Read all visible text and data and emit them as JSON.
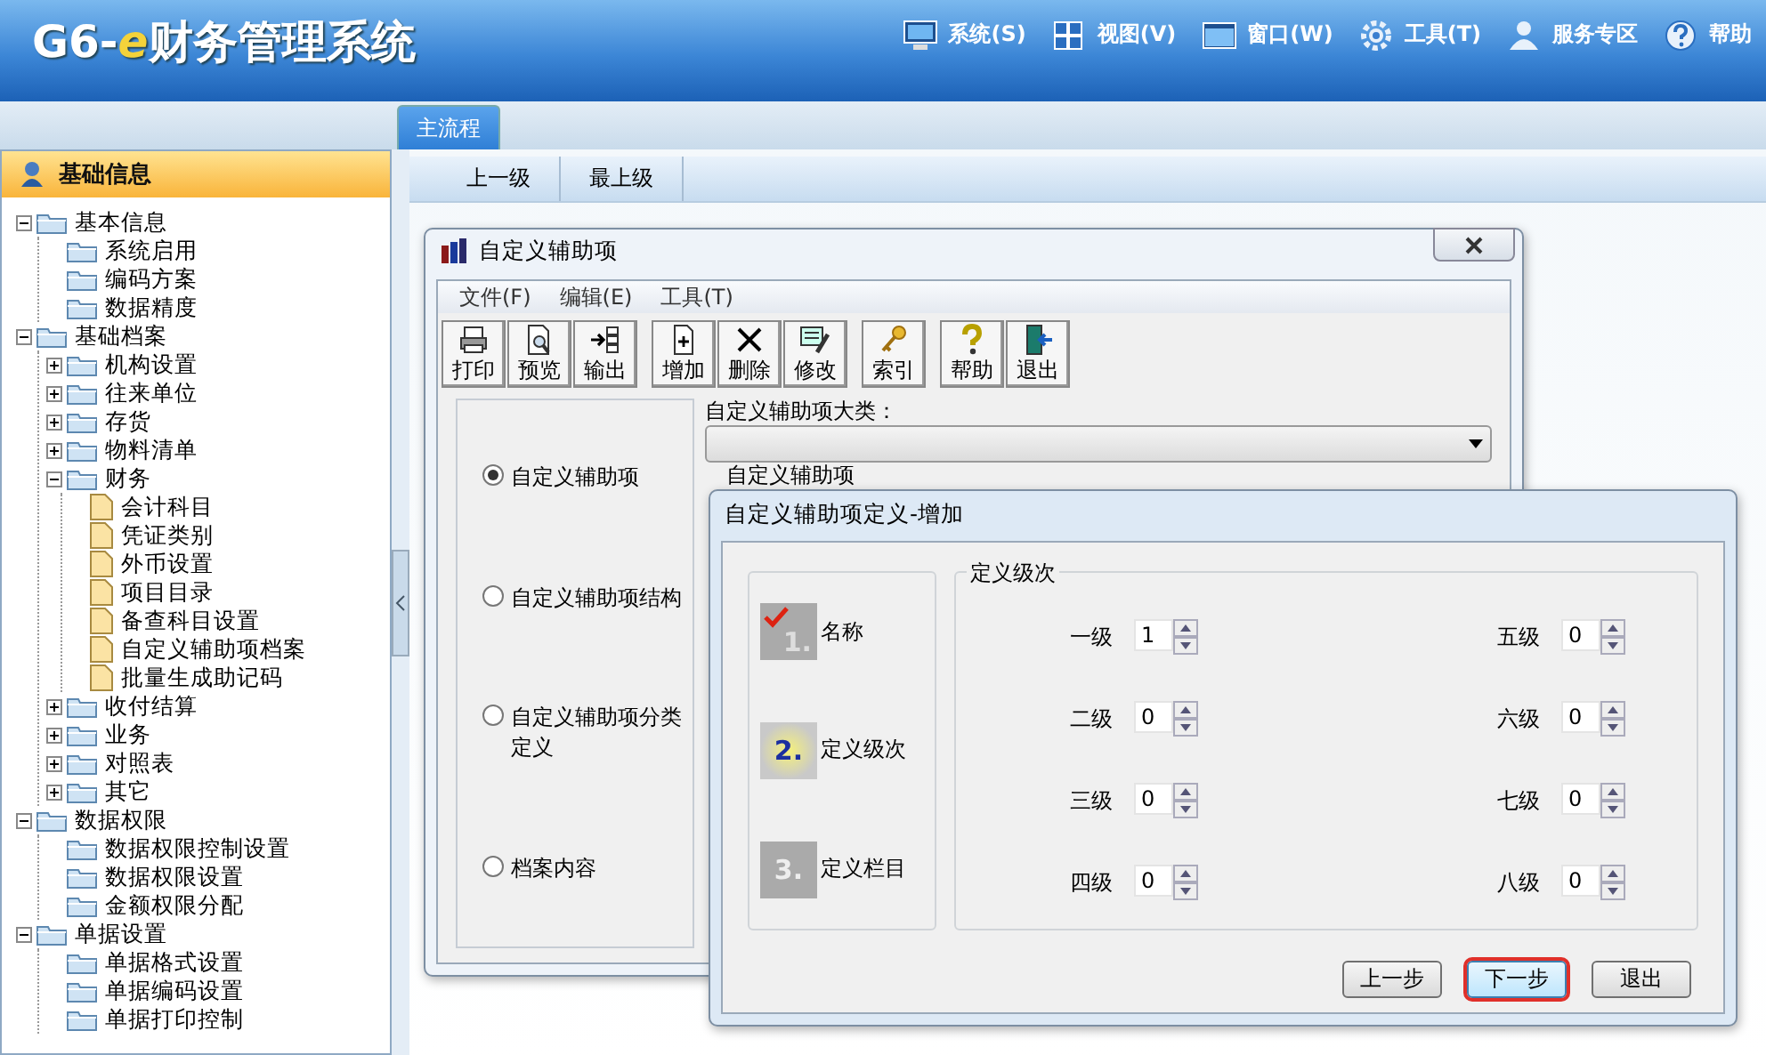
{
  "header": {
    "logo": {
      "prefix": "G6-",
      "accent": "e",
      "name": "财务管理系统"
    },
    "menu": [
      {
        "label": "系统(S)",
        "kind": "monitor"
      },
      {
        "label": "视图(V)",
        "kind": "grid"
      },
      {
        "label": "窗口(W)",
        "kind": "window"
      },
      {
        "label": "工具(T)",
        "kind": "gear"
      },
      {
        "label": "服务专区",
        "kind": "user"
      },
      {
        "label": "帮助",
        "kind": "help"
      }
    ]
  },
  "tabs": [
    {
      "label": "主流程",
      "selected": true
    }
  ],
  "sidebar": {
    "title": "基础信息",
    "tree": [
      {
        "label": "基本信息",
        "kind": "folder",
        "expanded": true,
        "children": [
          {
            "label": "系统启用",
            "kind": "folder"
          },
          {
            "label": "编码方案",
            "kind": "folder"
          },
          {
            "label": "数据精度",
            "kind": "folder"
          }
        ]
      },
      {
        "label": "基础档案",
        "kind": "folder",
        "expanded": true,
        "children": [
          {
            "label": "机构设置",
            "kind": "folder",
            "expanded": false
          },
          {
            "label": "往来单位",
            "kind": "folder",
            "expanded": false
          },
          {
            "label": "存货",
            "kind": "folder",
            "expanded": false
          },
          {
            "label": "物料清单",
            "kind": "folder",
            "expanded": false
          },
          {
            "label": "财务",
            "kind": "folder",
            "expanded": true,
            "children": [
              {
                "label": "会计科目",
                "kind": "document"
              },
              {
                "label": "凭证类别",
                "kind": "document"
              },
              {
                "label": "外币设置",
                "kind": "document"
              },
              {
                "label": "项目目录",
                "kind": "document"
              },
              {
                "label": "备查科目设置",
                "kind": "document"
              },
              {
                "label": "自定义辅助项档案",
                "kind": "document"
              },
              {
                "label": "批量生成助记码",
                "kind": "document"
              }
            ]
          },
          {
            "label": "收付结算",
            "kind": "folder",
            "expanded": false
          },
          {
            "label": "业务",
            "kind": "folder",
            "expanded": false
          },
          {
            "label": "对照表",
            "kind": "folder",
            "expanded": false
          },
          {
            "label": "其它",
            "kind": "folder",
            "expanded": false
          }
        ]
      },
      {
        "label": "数据权限",
        "kind": "folder",
        "expanded": true,
        "children": [
          {
            "label": "数据权限控制设置",
            "kind": "folder"
          },
          {
            "label": "数据权限设置",
            "kind": "folder"
          },
          {
            "label": "金额权限分配",
            "kind": "folder"
          }
        ]
      },
      {
        "label": "单据设置",
        "kind": "folder",
        "expanded": true,
        "children": [
          {
            "label": "单据格式设置",
            "kind": "folder"
          },
          {
            "label": "单据编码设置",
            "kind": "folder"
          },
          {
            "label": "单据打印控制",
            "kind": "folder"
          }
        ]
      }
    ]
  },
  "nav_buttons": [
    "上一级",
    "最上级"
  ],
  "list_window": {
    "title": "自定义辅助项",
    "menu": [
      "文件(F)",
      "编辑(E)",
      "工具(T)"
    ],
    "toolbar": [
      [
        {
          "label": "打印",
          "kind": "printer"
        },
        {
          "label": "预览",
          "kind": "preview"
        },
        {
          "label": "输出",
          "kind": "export"
        }
      ],
      [
        {
          "label": "增加",
          "kind": "add"
        },
        {
          "label": "删除",
          "kind": "delete"
        },
        {
          "label": "修改",
          "kind": "edit"
        }
      ],
      [
        {
          "label": "索引",
          "kind": "key"
        }
      ],
      [
        {
          "label": "帮助",
          "kind": "help"
        },
        {
          "label": "退出",
          "kind": "exit"
        }
      ]
    ],
    "options": [
      {
        "label": "自定义辅助项",
        "selected": true
      },
      {
        "label": "自定义辅助项结构",
        "selected": false
      },
      {
        "label": "自定义辅助项分类定义",
        "selected": false
      },
      {
        "label": "档案内容",
        "selected": false
      }
    ],
    "category_label": "自定义辅助项大类：",
    "group_label": "自定义辅助项"
  },
  "define_dialog": {
    "title": "自定义辅助项定义-增加",
    "steps": [
      {
        "number": "1.",
        "label": "名称",
        "kind": "done"
      },
      {
        "number": "2.",
        "label": "定义级次",
        "kind": "current"
      },
      {
        "number": "3.",
        "label": "定义栏目",
        "kind": "pending"
      }
    ],
    "group_label": "定义级次",
    "levels": [
      {
        "label": "一级",
        "value": "1"
      },
      {
        "label": "二级",
        "value": "0"
      },
      {
        "label": "三级",
        "value": "0"
      },
      {
        "label": "四级",
        "value": "0"
      },
      {
        "label": "五级",
        "value": "0"
      },
      {
        "label": "六级",
        "value": "0"
      },
      {
        "label": "七级",
        "value": "0"
      },
      {
        "label": "八级",
        "value": "0"
      }
    ],
    "buttons": [
      {
        "label": "上一步",
        "highlighted": false
      },
      {
        "label": "下一步",
        "highlighted": true
      },
      {
        "label": "退出",
        "highlighted": false
      }
    ]
  }
}
